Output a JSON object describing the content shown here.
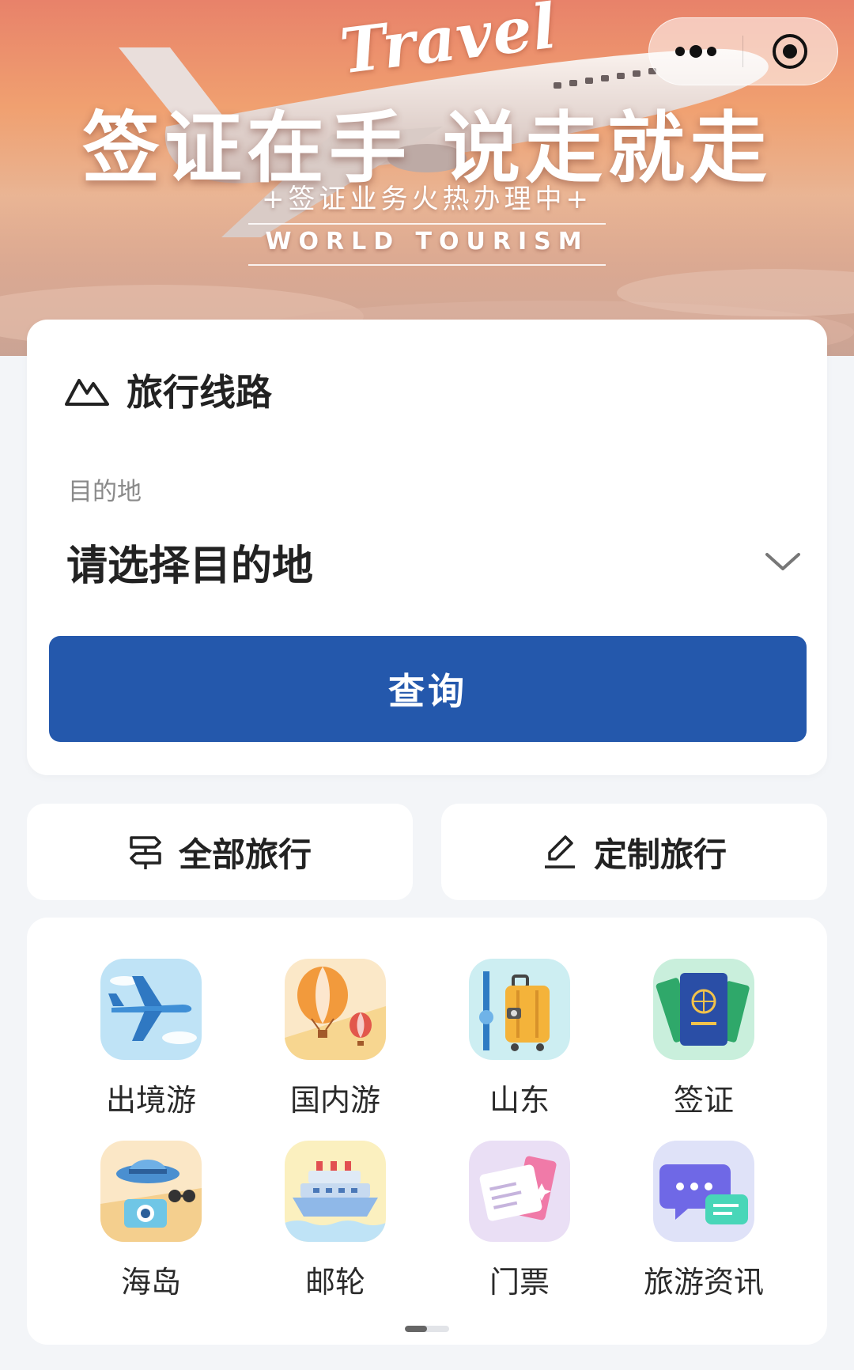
{
  "banner": {
    "script": "Travel",
    "title": "签证在手 说走就走",
    "subtitle": "+签证业务火热办理中+",
    "tagline": "WORLD TOURISM"
  },
  "search": {
    "header_icon": "mountain-icon",
    "header_title": "旅行线路",
    "destination_label": "目的地",
    "destination_value": "请选择目的地",
    "query_button": "查询"
  },
  "actions": [
    {
      "label": "全部旅行",
      "icon": "signpost-icon"
    },
    {
      "label": "定制旅行",
      "icon": "edit-icon"
    }
  ],
  "categories": [
    {
      "label": "出境游",
      "icon": "airplane-icon"
    },
    {
      "label": "国内游",
      "icon": "hot-air-balloon-icon"
    },
    {
      "label": "山东",
      "icon": "suitcase-icon"
    },
    {
      "label": "签证",
      "icon": "passport-icon"
    },
    {
      "label": "海岛",
      "icon": "beach-hat-icon"
    },
    {
      "label": "邮轮",
      "icon": "cruise-ship-icon"
    },
    {
      "label": "门票",
      "icon": "ticket-icon"
    },
    {
      "label": "旅游资讯",
      "icon": "chat-bubble-icon"
    }
  ],
  "pager": {
    "page_count": 2,
    "active_page": 1
  },
  "colors": {
    "primary": "#2458ac",
    "background": "#f3f5f8"
  }
}
